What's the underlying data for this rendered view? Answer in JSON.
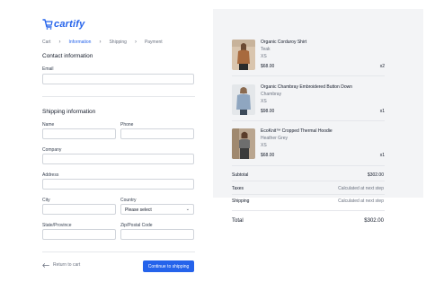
{
  "brand": {
    "name": "cartify",
    "accent": "#2563eb"
  },
  "breadcrumb": [
    {
      "label": "Cart",
      "active": false
    },
    {
      "label": "Information",
      "active": true
    },
    {
      "label": "Shipping",
      "active": false
    },
    {
      "label": "Payment",
      "active": false
    }
  ],
  "contact": {
    "title": "Contact information",
    "email_label": "Email",
    "email_value": ""
  },
  "shipping": {
    "title": "Shipping information",
    "name_label": "Name",
    "phone_label": "Phone",
    "company_label": "Company",
    "address_label": "Address",
    "city_label": "City",
    "country_label": "Country",
    "country_value": "Please select",
    "state_label": "State/Province",
    "zip_label": "Zip/Postal Code"
  },
  "actions": {
    "back_label": "Return to cart",
    "continue_label": "Continue to shipping"
  },
  "cart": {
    "items": [
      {
        "name": "Organic Corduroy Shirt",
        "color": "Teak",
        "size": "XS",
        "price": "$68.00",
        "qty": "x2"
      },
      {
        "name": "Organic Chambray Embroidered Button Down",
        "color": "Chambray",
        "size": "XS",
        "price": "$98.00",
        "qty": "x1"
      },
      {
        "name": "EcoKnit™ Cropped Thermal Hoodie",
        "color": "Heather Grey",
        "size": "XS",
        "price": "$68.00",
        "qty": "x1"
      }
    ],
    "summary": {
      "subtotal_label": "Subtotal",
      "subtotal_value": "$302.00",
      "taxes_label": "Taxes",
      "taxes_value": "Calculated at next step",
      "shipping_label": "Shipping",
      "shipping_value": "Calculated at next step",
      "total_label": "Total",
      "total_value": "$302.00"
    }
  }
}
